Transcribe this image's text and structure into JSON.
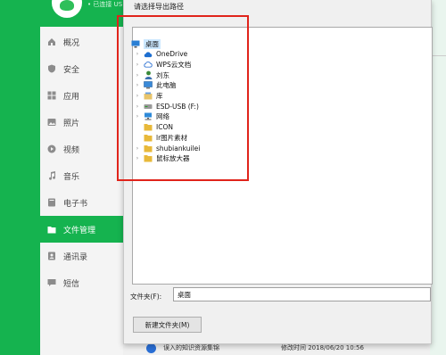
{
  "app": {
    "user_text": "• 已连接 US"
  },
  "sidebar": {
    "items": [
      {
        "label": "概况",
        "icon": "home-icon"
      },
      {
        "label": "安全",
        "icon": "shield-icon"
      },
      {
        "label": "应用",
        "icon": "apps-icon"
      },
      {
        "label": "照片",
        "icon": "photo-icon"
      },
      {
        "label": "视频",
        "icon": "video-icon"
      },
      {
        "label": "音乐",
        "icon": "music-icon"
      },
      {
        "label": "电子书",
        "icon": "ebook-icon"
      },
      {
        "label": "文件管理",
        "icon": "folder-icon",
        "active": true
      },
      {
        "label": "通讯录",
        "icon": "contacts-icon"
      },
      {
        "label": "短信",
        "icon": "sms-icon"
      }
    ],
    "accent_color": "#15b34f"
  },
  "background_row": {
    "name": "误入的知识资源集锦",
    "modified_label": "修改时间 2018/06/20 10:56"
  },
  "dialog": {
    "title": "请选择导出路径",
    "tree": [
      {
        "label": "桌面",
        "icon": "desktop-icon",
        "level": 0,
        "expandable": false,
        "selected": true
      },
      {
        "label": "OneDrive",
        "icon": "cloud-icon",
        "level": 1,
        "expandable": true
      },
      {
        "label": "WPS云文档",
        "icon": "wps-cloud-icon",
        "level": 1,
        "expandable": true
      },
      {
        "label": "刘东",
        "icon": "user-icon",
        "level": 1,
        "expandable": true
      },
      {
        "label": "此电脑",
        "icon": "computer-icon",
        "level": 1,
        "expandable": true
      },
      {
        "label": "库",
        "icon": "library-icon",
        "level": 1,
        "expandable": true
      },
      {
        "label": "ESD-USB (F:)",
        "icon": "usb-drive-icon",
        "level": 1,
        "expandable": true
      },
      {
        "label": "网络",
        "icon": "network-icon",
        "level": 1,
        "expandable": true
      },
      {
        "label": "ICON",
        "icon": "folder-icon",
        "level": 1,
        "expandable": false
      },
      {
        "label": "lr图片素材",
        "icon": "folder-icon",
        "level": 1,
        "expandable": false
      },
      {
        "label": "shubiankuilei",
        "icon": "folder-icon",
        "level": 1,
        "expandable": true
      },
      {
        "label": "鼠标放大器",
        "icon": "folder-icon",
        "level": 1,
        "expandable": true
      }
    ],
    "folder_label": "文件夹(F):",
    "folder_value": "桌面",
    "new_folder_button": "新建文件夹(M)",
    "highlight_color": "#e0241b"
  }
}
